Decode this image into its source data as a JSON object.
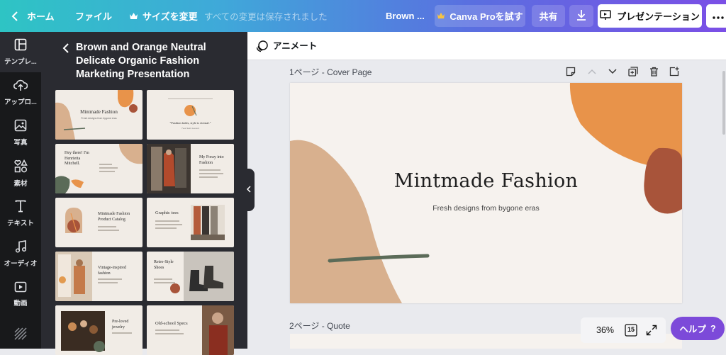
{
  "topbar": {
    "home": "ホーム",
    "file": "ファイル",
    "resize": "サイズを変更",
    "save_status": "すべての変更は保存されました",
    "doc_title": "Brown ...",
    "try_pro": "Canva Proを試す",
    "share": "共有",
    "present": "プレゼンテーション"
  },
  "rail": [
    {
      "label": "テンプレ...",
      "icon": "template-icon"
    },
    {
      "label": "アップロ...",
      "icon": "upload-icon"
    },
    {
      "label": "写真",
      "icon": "photo-icon"
    },
    {
      "label": "素材",
      "icon": "elements-icon"
    },
    {
      "label": "テキスト",
      "icon": "text-icon"
    },
    {
      "label": "オーディオ",
      "icon": "audio-icon"
    },
    {
      "label": "動画",
      "icon": "video-icon"
    }
  ],
  "panel": {
    "title": "Brown and Orange Neutral Delicate Organic Fashion Marketing Presentation",
    "thumbs": [
      {
        "title": "Mintmade Fashion",
        "sub": "Fresh designs from bygone eras"
      },
      {
        "title": "\"Fashion fades, style is eternal.\"",
        "sub": "Yves Saint Laurent"
      },
      {
        "title": "Hey there! I'm Henrietta Mitchell.",
        "sub": ""
      },
      {
        "title": "My Foray into Fashion",
        "sub": ""
      },
      {
        "title": "Mintmade Fashion Product Catalog",
        "sub": ""
      },
      {
        "title": "Graphic tees",
        "sub": ""
      },
      {
        "title": "Vintage-inspired fashion",
        "sub": ""
      },
      {
        "title": "Retro-Style Shoes",
        "sub": ""
      },
      {
        "title": "Pre-loved jewelry",
        "sub": ""
      },
      {
        "title": "Old-school Specs",
        "sub": ""
      }
    ]
  },
  "editor": {
    "animate": "アニメート",
    "page1_label": "1ページ - Cover Page",
    "page2_label": "2ページ - Quote",
    "slide": {
      "title": "Mintmade Fashion",
      "subtitle": "Fresh designs from bygone eras"
    },
    "zoom": "36%",
    "page_count": "15",
    "help": "ヘルプ",
    "help_mark": "?"
  },
  "colors": {
    "accent_purple": "#7c4ad9",
    "rail_bg": "#18191b",
    "panel_bg": "#2a2b31",
    "blob_orange": "#e8934a",
    "blob_rust": "#a8543a",
    "blob_tan": "#d8b08e",
    "stroke_green": "#5b6b58"
  }
}
